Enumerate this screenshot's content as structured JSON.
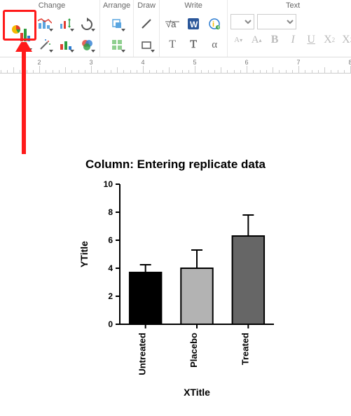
{
  "ribbon": {
    "groups": {
      "change": {
        "title": "Change"
      },
      "arrange": {
        "title": "Arrange"
      },
      "draw": {
        "title": "Draw"
      },
      "write": {
        "title": "Write"
      },
      "text": {
        "title": "Text"
      }
    },
    "font_select_value": "",
    "format_buttons": {
      "font_smaller": "A",
      "font_larger": "A",
      "bold": "B",
      "italic": "I",
      "underline": "U",
      "super": "X",
      "sub": "X"
    }
  },
  "ruler_start": 1,
  "chart_data": {
    "type": "bar",
    "title": "Column: Entering replicate data",
    "xlabel": "XTitle",
    "ylabel": "YTitle",
    "ylim": [
      0,
      10
    ],
    "yticks": [
      0,
      2,
      4,
      6,
      8,
      10
    ],
    "categories": [
      "Untreated",
      "Placebo",
      "Treated"
    ],
    "values": [
      3.7,
      4.0,
      6.3
    ],
    "errors": [
      0.55,
      1.3,
      1.5
    ],
    "colors": [
      "#000000",
      "#b3b3b3",
      "#666666"
    ]
  }
}
